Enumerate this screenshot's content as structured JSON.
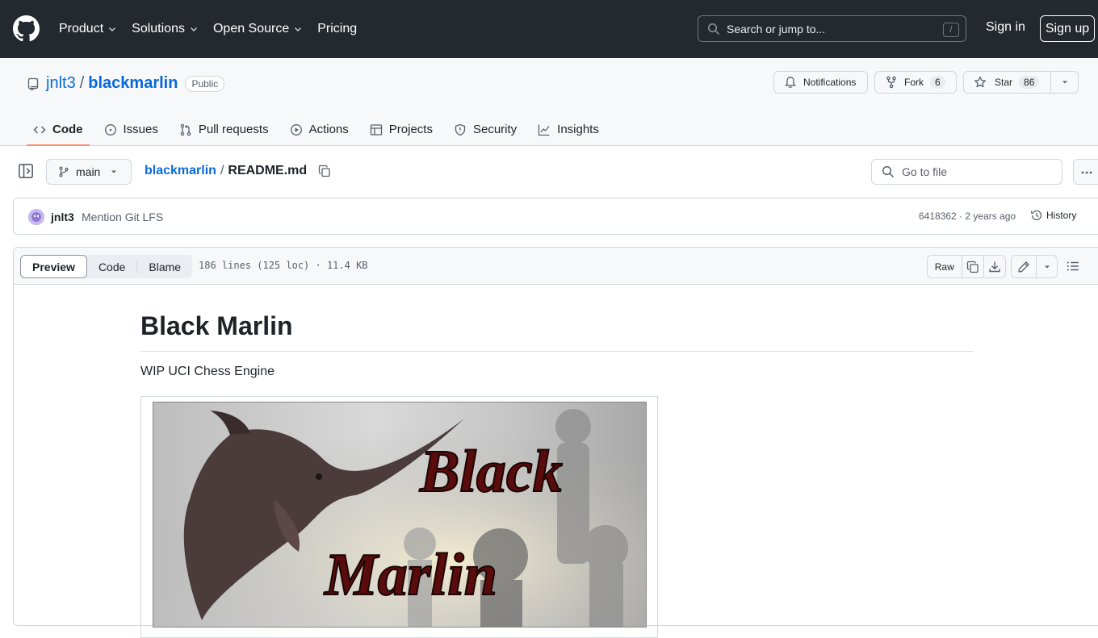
{
  "header": {
    "nav": [
      {
        "label": "Product",
        "dropdown": true
      },
      {
        "label": "Solutions",
        "dropdown": true
      },
      {
        "label": "Open Source",
        "dropdown": true
      },
      {
        "label": "Pricing",
        "dropdown": false
      }
    ],
    "search_placeholder": "Search or jump to...",
    "search_shortcut": "/",
    "sign_in": "Sign in",
    "sign_up": "Sign up"
  },
  "repo": {
    "owner": "jnlt3",
    "separator": "/",
    "name": "blackmarlin",
    "visibility": "Public",
    "notifications_label": "Notifications",
    "fork_label": "Fork",
    "fork_count": "6",
    "star_label": "Star",
    "star_count": "86",
    "tabs": [
      {
        "label": "Code",
        "icon": "code-icon",
        "active": true
      },
      {
        "label": "Issues",
        "icon": "issue-icon"
      },
      {
        "label": "Pull requests",
        "icon": "pull-request-icon"
      },
      {
        "label": "Actions",
        "icon": "play-icon"
      },
      {
        "label": "Projects",
        "icon": "table-icon"
      },
      {
        "label": "Security",
        "icon": "shield-icon"
      },
      {
        "label": "Insights",
        "icon": "graph-icon"
      }
    ]
  },
  "filenav": {
    "branch": "main",
    "repo_link": "blackmarlin",
    "separator": "/",
    "file": "README.md",
    "goto_placeholder": "Go to file"
  },
  "commit": {
    "user": "jnlt3",
    "message": "Mention Git LFS",
    "sha_time": "6418362 · 2 years ago",
    "history_label": "History"
  },
  "viewer": {
    "modes": [
      "Preview",
      "Code",
      "Blame"
    ],
    "active_mode": "Preview",
    "meta": "186 lines (125 loc) · 11.4 KB",
    "raw_label": "Raw"
  },
  "readme": {
    "title": "Black Marlin",
    "subtitle": "WIP UCI Chess Engine",
    "banner_text_line1": "Black",
    "banner_text_line2": "Marlin"
  },
  "colors": {
    "header_bg": "#24292f",
    "link": "#0969da",
    "tab_underline": "#fd8c73",
    "border": "#d0d7de"
  }
}
